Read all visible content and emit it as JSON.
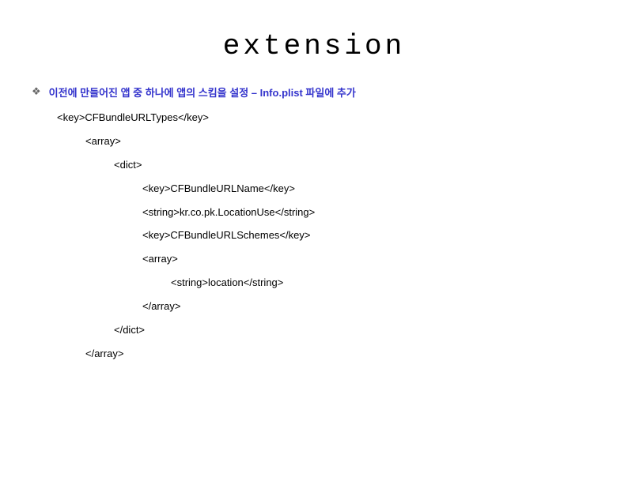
{
  "title": "extension",
  "bullet": {
    "symbol": "❖",
    "text": "이전에 만들어진 앱 중 하나에 앱의 스킴을 설정 – Info.plist 파일에 추가"
  },
  "code": {
    "lines": [
      {
        "text": "<key>CFBundleURLTypes</key>",
        "indent": 1
      },
      {
        "text": "<array>",
        "indent": 2
      },
      {
        "text": "<dict>",
        "indent": 3
      },
      {
        "text": "<key>CFBundleURLName</key>",
        "indent": 4
      },
      {
        "text": "<string>kr.co.pk.LocationUse</string>",
        "indent": 4
      },
      {
        "text": "<key>CFBundleURLSchemes</key>",
        "indent": 4
      },
      {
        "text": "<array>",
        "indent": 4
      },
      {
        "text": "<string>location</string>",
        "indent": 5
      },
      {
        "text": "</array>",
        "indent": 4
      },
      {
        "text": "</dict>",
        "indent": 3
      },
      {
        "text": "</array>",
        "indent": 2
      }
    ]
  }
}
